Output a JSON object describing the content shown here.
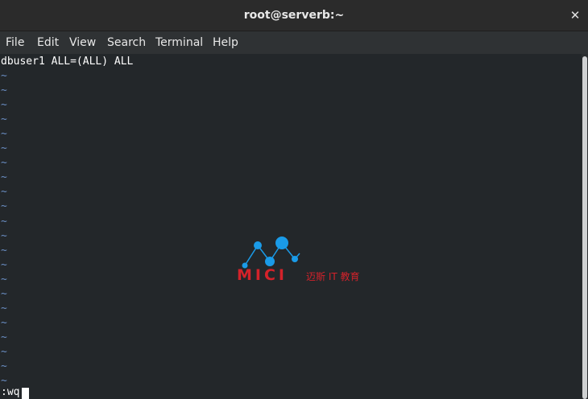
{
  "window": {
    "title": "root@serverb:~",
    "close_glyph": "✕"
  },
  "menu": [
    "File",
    "Edit",
    "View",
    "Search",
    "Terminal",
    "Help"
  ],
  "editor": {
    "content_line": "dbuser1 ALL=(ALL) ALL",
    "empty_line_marker": "~",
    "empty_line_count": 22,
    "command_line": ":wq"
  },
  "watermark": {
    "brand": "MICI",
    "subtitle": "迈斯 IT 教育"
  },
  "colors": {
    "tilde": "#6a8ec4",
    "watermark_red": "#d3222a",
    "watermark_blue": "#1a9be8"
  }
}
